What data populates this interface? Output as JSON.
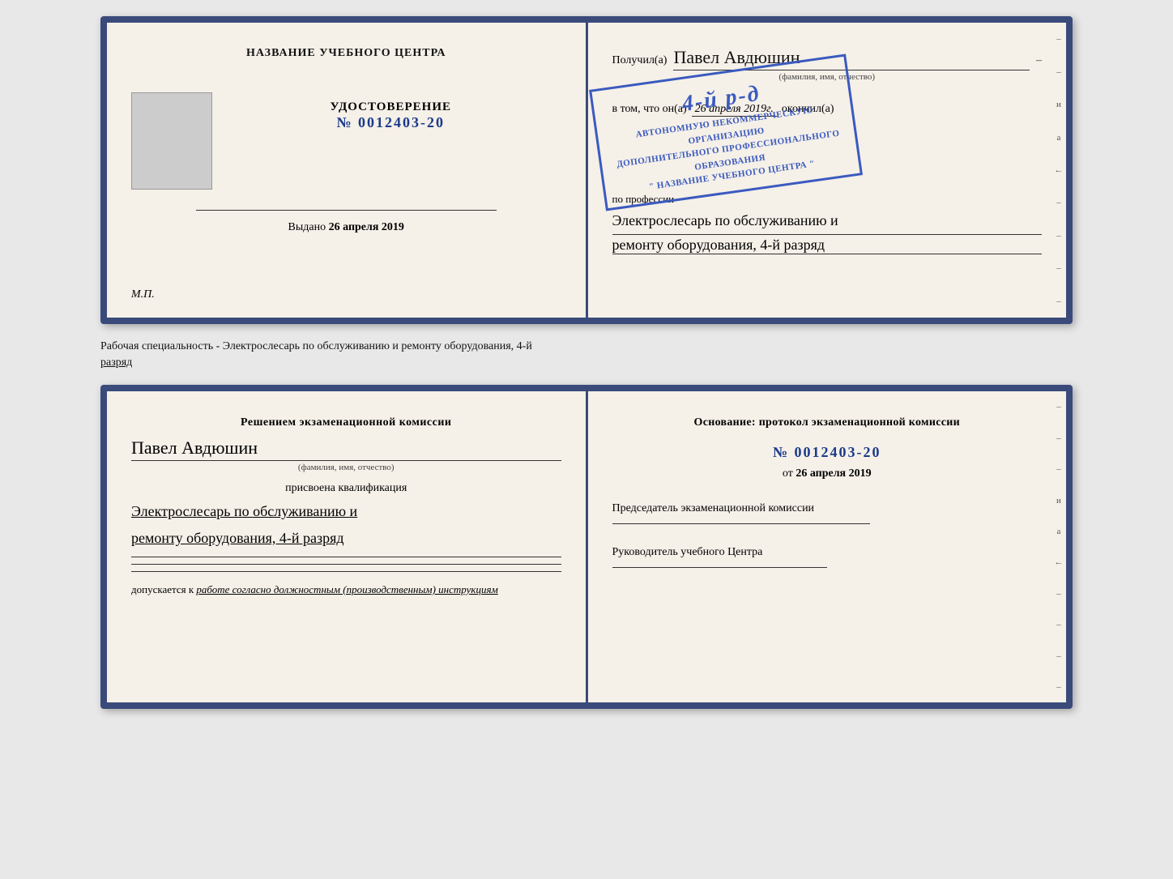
{
  "top_left": {
    "title": "НАЗВАНИЕ УЧЕБНОГО ЦЕНТРА",
    "photo_alt": "фото",
    "udost_label": "УДОСТОВЕРЕНИЕ",
    "udost_number": "№ 0012403-20",
    "vydano_label": "Выдано",
    "vydano_date": "26 апреля 2019",
    "mp_label": "М.П."
  },
  "top_right": {
    "poluchil_label": "Получил(а)",
    "recipient_name": "Павел Авдюшин",
    "fio_label": "(фамилия, имя, отчество)",
    "dash": "–",
    "vtom_prefix": "в том, что он(а)",
    "vtom_date": "26 апреля 2019г.",
    "vtom_suffix": "окончил(а)",
    "stamp_line1": "АВТОНОМНУЮ НЕКОММЕРЧЕСКУЮ ОРГАНИЗАЦИЮ",
    "stamp_line2": "ДОПОЛНИТЕЛЬНОГО ПРОФЕССИОНАЛЬНОГО ОБРАЗОВАНИЯ",
    "stamp_big": "4-й р-д",
    "stamp_center": "\" НАЗВАНИЕ УЧЕБНОГО ЦЕНТРА \"",
    "profession_label": "по профессии",
    "profession_value": "Электрослесарь по обслуживанию и",
    "profession_value2": "ремонту оборудования, 4-й разряд"
  },
  "separator": {
    "text": "Рабочая специальность - Электрослесарь по обслуживанию и ремонту оборудования, 4-й",
    "text2": "разряд"
  },
  "bottom_left": {
    "title": "Решением экзаменационной комиссии",
    "name": "Павел Авдюшин",
    "fio_label": "(фамилия, имя, отчество)",
    "prisvoena": "присвоена квалификация",
    "qualification1": "Электрослесарь по обслуживанию и",
    "qualification2": "ремонту оборудования, 4-й разряд",
    "dopusk_label": "допускается к",
    "dopusk_value": "работе согласно должностным (производственным) инструкциям"
  },
  "bottom_right": {
    "osnov_label": "Основание: протокол экзаменационной комиссии",
    "number": "№ 0012403-20",
    "ot_label": "от",
    "ot_date": "26 апреля 2019",
    "predsed_label": "Председатель экзаменационной комиссии",
    "ruk_label": "Руководитель учебного Центра"
  },
  "side_chars": [
    "–",
    "–",
    "и",
    "а",
    "←",
    "–",
    "–",
    "–",
    "–"
  ]
}
